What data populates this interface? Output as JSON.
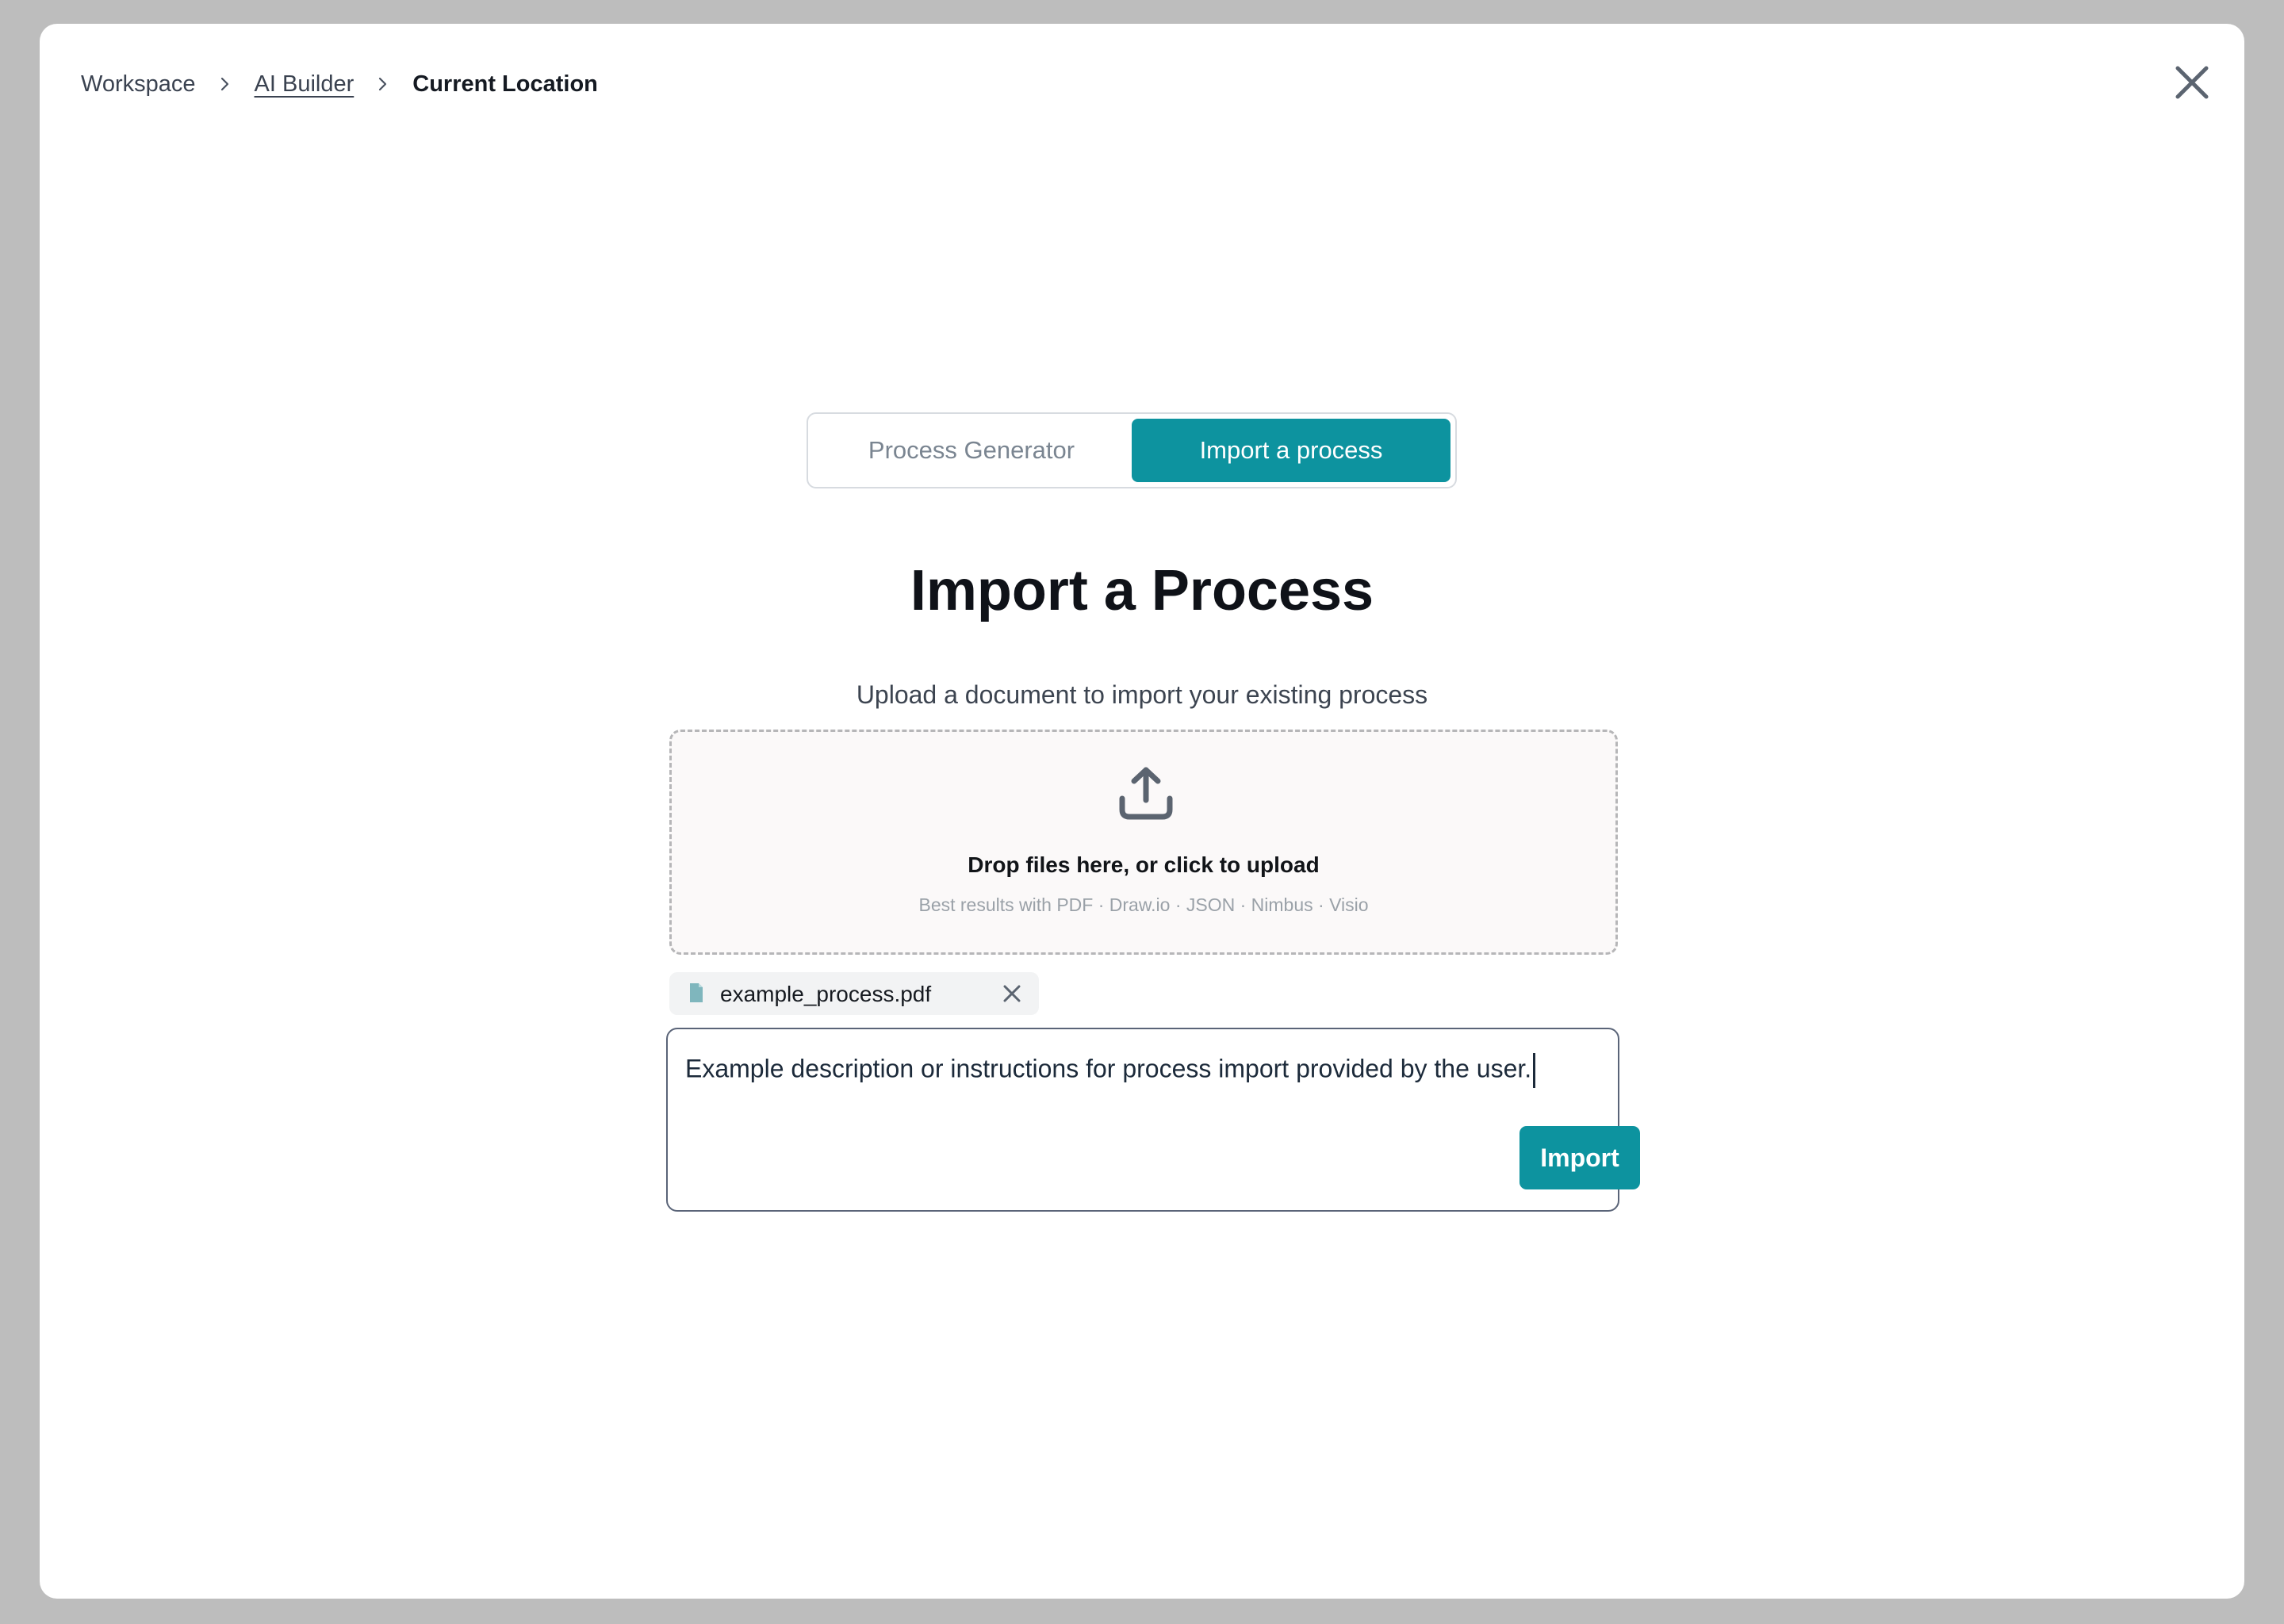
{
  "breadcrumb": {
    "items": [
      "Workspace",
      "AI Builder",
      "Current Location"
    ]
  },
  "icons": {
    "close": "close-icon",
    "separator": "chevron-right-icon",
    "upload": "upload-icon",
    "file": "file-icon",
    "remove": "close-icon"
  },
  "toggle": {
    "options": [
      "Process Generator",
      "Import a process"
    ],
    "active": "Import a process"
  },
  "page": {
    "title": "Import a Process",
    "subtitle": "Upload a document to import your existing process"
  },
  "dropzone": {
    "title": "Drop files here, or click to upload",
    "hint": "Best results with PDF ·  Draw.io · JSON · Nimbus · Visio"
  },
  "attachment": {
    "file_name": "example_process.pdf"
  },
  "instructions": {
    "value": "Example description or instructions for process import provided by the user."
  },
  "actions": {
    "import_label": "Import"
  },
  "colors": {
    "accent": "#0d939f",
    "backdrop": "#bdbdbd",
    "panel": "#ffffff"
  }
}
